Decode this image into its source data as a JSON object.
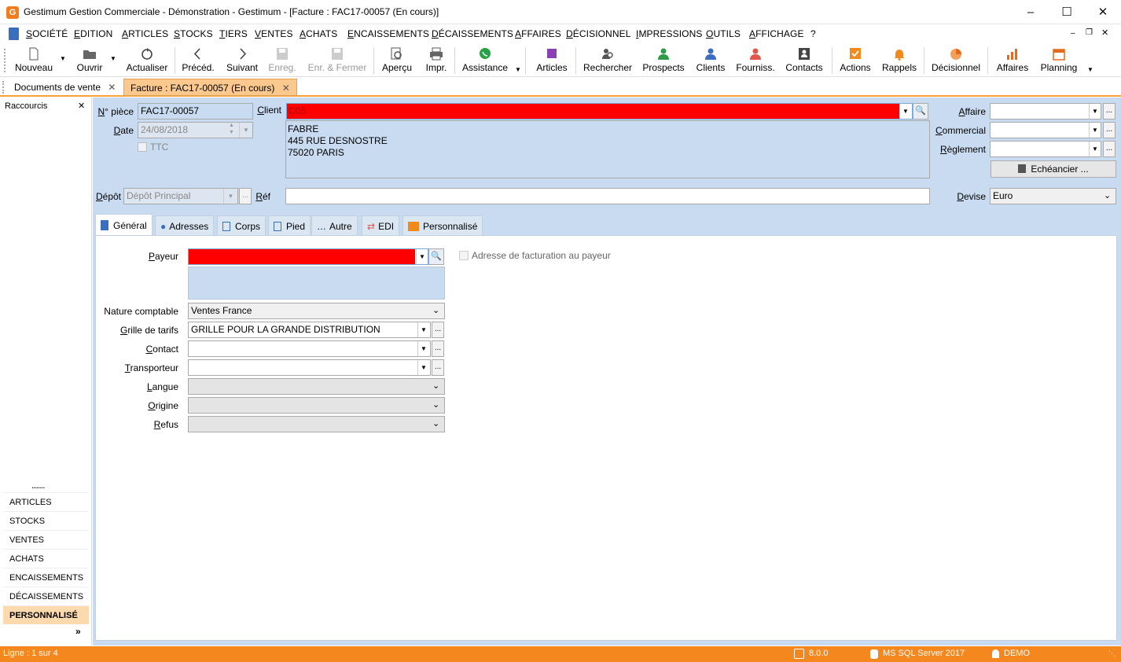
{
  "window": {
    "title": "Gestimum Gestion Commerciale - Démonstration - Gestimum - [Facture : FAC17-00057 (En cours)]",
    "logo": "G"
  },
  "menu": [
    "SOCIÉTÉ",
    "EDITION",
    "ARTICLES",
    "STOCKS",
    "TIERS",
    "VENTES",
    "ACHATS",
    "ENCAISSEMENTS",
    "DÉCAISSEMENTS",
    "AFFAIRES",
    "DÉCISIONNEL",
    "IMPRESSIONS",
    "OUTILS",
    "AFFICHAGE",
    "?"
  ],
  "toolbar": [
    {
      "label": "Nouveau",
      "icon": "new-document-icon",
      "color": "#555555"
    },
    {
      "label": "Ouvrir",
      "icon": "folder-open-icon",
      "color": "#555555"
    },
    {
      "label": "Actualiser",
      "icon": "refresh-icon",
      "color": "#444444"
    },
    {
      "label": "Précéd.",
      "icon": "chevron-left-icon",
      "color": "#444444"
    },
    {
      "label": "Suivant",
      "icon": "chevron-right-icon",
      "color": "#444444"
    },
    {
      "label": "Enreg.",
      "icon": "save-icon",
      "color": "#aaaaaa",
      "disabled": true
    },
    {
      "label": "Enr. & Fermer",
      "icon": "save-close-icon",
      "color": "#aaaaaa",
      "disabled": true
    },
    {
      "label": "Aperçu",
      "icon": "preview-icon",
      "color": "#555555"
    },
    {
      "label": "Impr.",
      "icon": "print-icon",
      "color": "#555555"
    },
    {
      "label": "Assistance",
      "icon": "whatsapp-icon",
      "color": "#25a244"
    },
    {
      "label": "Articles",
      "icon": "articles-icon",
      "color": "#8a3fb5"
    },
    {
      "label": "Rechercher",
      "icon": "search-people-icon",
      "color": "#555555"
    },
    {
      "label": "Prospects",
      "icon": "prospect-icon",
      "color": "#2e9b47"
    },
    {
      "label": "Clients",
      "icon": "client-icon",
      "color": "#3a6fbf"
    },
    {
      "label": "Fourniss.",
      "icon": "supplier-icon",
      "color": "#e0564a"
    },
    {
      "label": "Contacts",
      "icon": "contact-card-icon",
      "color": "#444444"
    },
    {
      "label": "Actions",
      "icon": "actions-check-icon",
      "color": "#f08a1c"
    },
    {
      "label": "Rappels",
      "icon": "bell-icon",
      "color": "#f08a1c"
    },
    {
      "label": "Décisionnel",
      "icon": "pie-chart-icon",
      "color": "#e46a1f"
    },
    {
      "label": "Affaires",
      "icon": "bar-chart-icon",
      "color": "#e46a1f"
    },
    {
      "label": "Planning",
      "icon": "calendar-icon",
      "color": "#e46a1f"
    }
  ],
  "doctabs": [
    {
      "label": "Documents de vente"
    },
    {
      "label": "Facture : FAC17-00057 (En cours)"
    }
  ],
  "sidebar": {
    "title": "Raccourcis",
    "dots": "........",
    "items": [
      "ARTICLES",
      "STOCKS",
      "VENTES",
      "ACHATS",
      "ENCAISSEMENTS",
      "DÉCAISSEMENTS",
      "PERSONNALISÉ"
    ],
    "selected": "PERSONNALISÉ",
    "more": "»"
  },
  "header": {
    "piece_label": "N° pièce",
    "piece_value": "FAC17-00057",
    "date_label": "Date",
    "date_value": "24/08/2018",
    "ttc_label": "TTC",
    "client_label": "Client",
    "client_value": "C05",
    "client_color": "#ff0000",
    "address": [
      "FABRE",
      "445 RUE DESNOSTRE",
      "75020 PARIS"
    ],
    "affaire_label": "Affaire",
    "commercial_label": "Commercial",
    "reglement_label": "Règlement",
    "echeancier_label": "Echéancier ...",
    "depot_label": "Dépôt",
    "depot_value": "Dépôt Principal",
    "ref_label": "Réf",
    "ref_value": "",
    "devise_label": "Devise",
    "devise_value": "Euro"
  },
  "tabs": [
    "Général",
    "Adresses",
    "Corps",
    "Pied",
    "Autre",
    "EDI",
    "Personnalisé"
  ],
  "active_tab": "Général",
  "general": {
    "payeur_label": "Payeur",
    "payeur_color": "#ff0000",
    "adresse_fact_label": "Adresse de facturation au payeur",
    "nature_label": "Nature comptable",
    "nature_value": "Ventes France",
    "grille_label": "Grille de tarifs",
    "grille_value": "GRILLE POUR LA GRANDE DISTRIBUTION",
    "contact_label": "Contact",
    "transporteur_label": "Transporteur",
    "langue_label": "Langue",
    "origine_label": "Origine",
    "refus_label": "Refus"
  },
  "status": {
    "line": "Ligne : 1 sur 4",
    "version": "8.0.0",
    "db": "MS SQL Server 2017",
    "user": "DEMO"
  }
}
